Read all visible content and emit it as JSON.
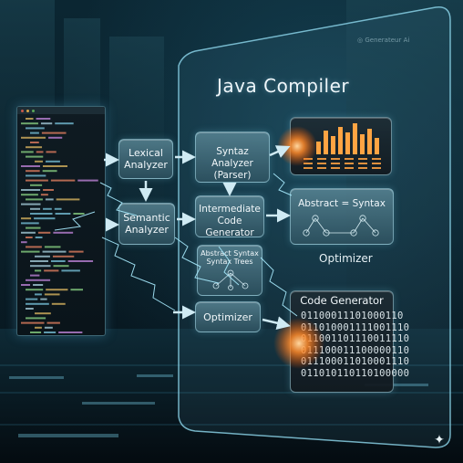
{
  "title": "Java Compiler",
  "boxes": {
    "lexical": "Lexical\nAnalyzer",
    "semantic": "Semantic\nAnalyzer",
    "syntax_parser": "Syntaz Analyzer\n(Parser)",
    "intermediate": "Intermediate\nCode Generator",
    "ast_trees": "Abstract Syntax\nSyntax Trees",
    "optimizer_box": "Optimizer",
    "abstract_syntax": "Abstract = Syntax",
    "code_generator": "Code Generator"
  },
  "optimizer_label": "Optimizer",
  "binary_lines": [
    "01100011101000110",
    "011010001111001110",
    "011001101110011110",
    "011100011100000110",
    "011100011010001110",
    "011010110110100000"
  ],
  "watermark": "◎ Generateur Ai",
  "colors": {
    "glow_orange": "#ff8a2a",
    "glow_cyan": "#8fe4ff",
    "box_fill": "#5f8c9b"
  }
}
